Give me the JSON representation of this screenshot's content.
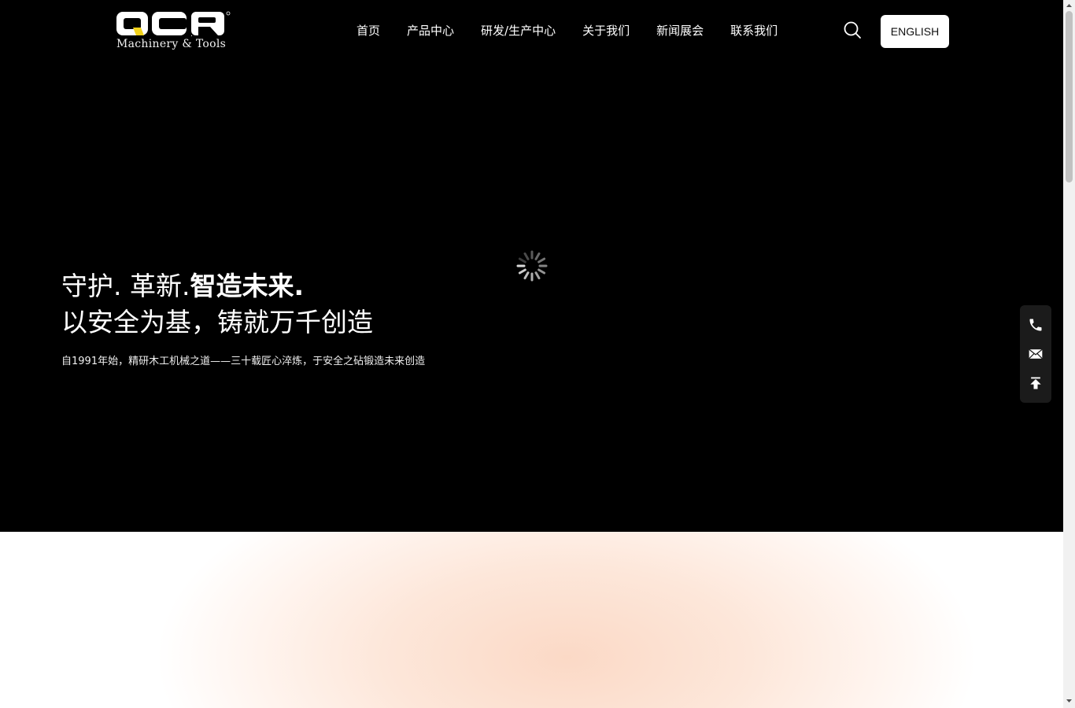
{
  "brand": {
    "logo_text": "QCR",
    "logo_subtitle": "Machinery & Tools"
  },
  "nav": {
    "items": [
      {
        "label": "首页"
      },
      {
        "label": "产品中心"
      },
      {
        "label": "研发/生产中心"
      },
      {
        "label": "关于我们"
      },
      {
        "label": "新闻展会"
      },
      {
        "label": "联系我们"
      }
    ]
  },
  "header": {
    "search_icon": "search-icon",
    "language_button": "ENGLISH"
  },
  "hero": {
    "headline_part1": "守护. 革新.",
    "headline_part2": "智造未来.",
    "headline_line2": "以安全为基，铸就万千创造",
    "subline": "自1991年始，精研木工机械之道——三十载匠心淬炼，于安全之砧锻造未来创造",
    "loading_icon": "spinner-icon"
  },
  "float_bar": {
    "icons": [
      "phone-icon",
      "mail-icon",
      "back-to-top-icon"
    ]
  },
  "colors": {
    "hero_background": "#000000",
    "text": "#ffffff",
    "logo_accent": "#f2d21b",
    "section_glow": "#fbd9c6"
  }
}
